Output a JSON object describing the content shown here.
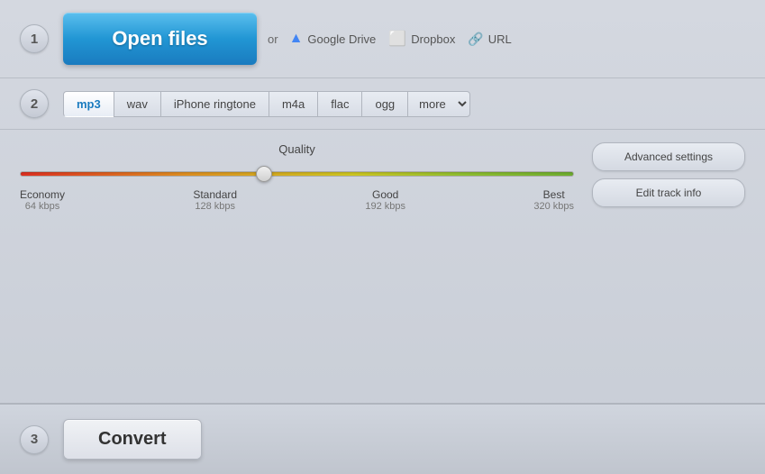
{
  "steps": {
    "step1": {
      "number": "1",
      "open_files_label": "Open files",
      "or_text": "or",
      "google_drive_label": "Google Drive",
      "dropbox_label": "Dropbox",
      "url_label": "URL"
    },
    "step2": {
      "number": "2",
      "formats": [
        {
          "id": "mp3",
          "label": "mp3",
          "active": true
        },
        {
          "id": "wav",
          "label": "wav",
          "active": false
        },
        {
          "id": "iphone-ringtone",
          "label": "iPhone ringtone",
          "active": false
        },
        {
          "id": "m4a",
          "label": "m4a",
          "active": false
        },
        {
          "id": "flac",
          "label": "flac",
          "active": false
        },
        {
          "id": "ogg",
          "label": "ogg",
          "active": false
        }
      ],
      "more_label": "more",
      "quality_title": "Quality",
      "quality_marks": [
        {
          "label": "Economy",
          "kbps": "64 kbps"
        },
        {
          "label": "Standard",
          "kbps": "128 kbps"
        },
        {
          "label": "Good",
          "kbps": "192 kbps"
        },
        {
          "label": "Best",
          "kbps": "320 kbps"
        }
      ],
      "advanced_settings_label": "Advanced settings",
      "edit_track_info_label": "Edit track info"
    },
    "step3": {
      "number": "3",
      "convert_label": "Convert"
    }
  }
}
